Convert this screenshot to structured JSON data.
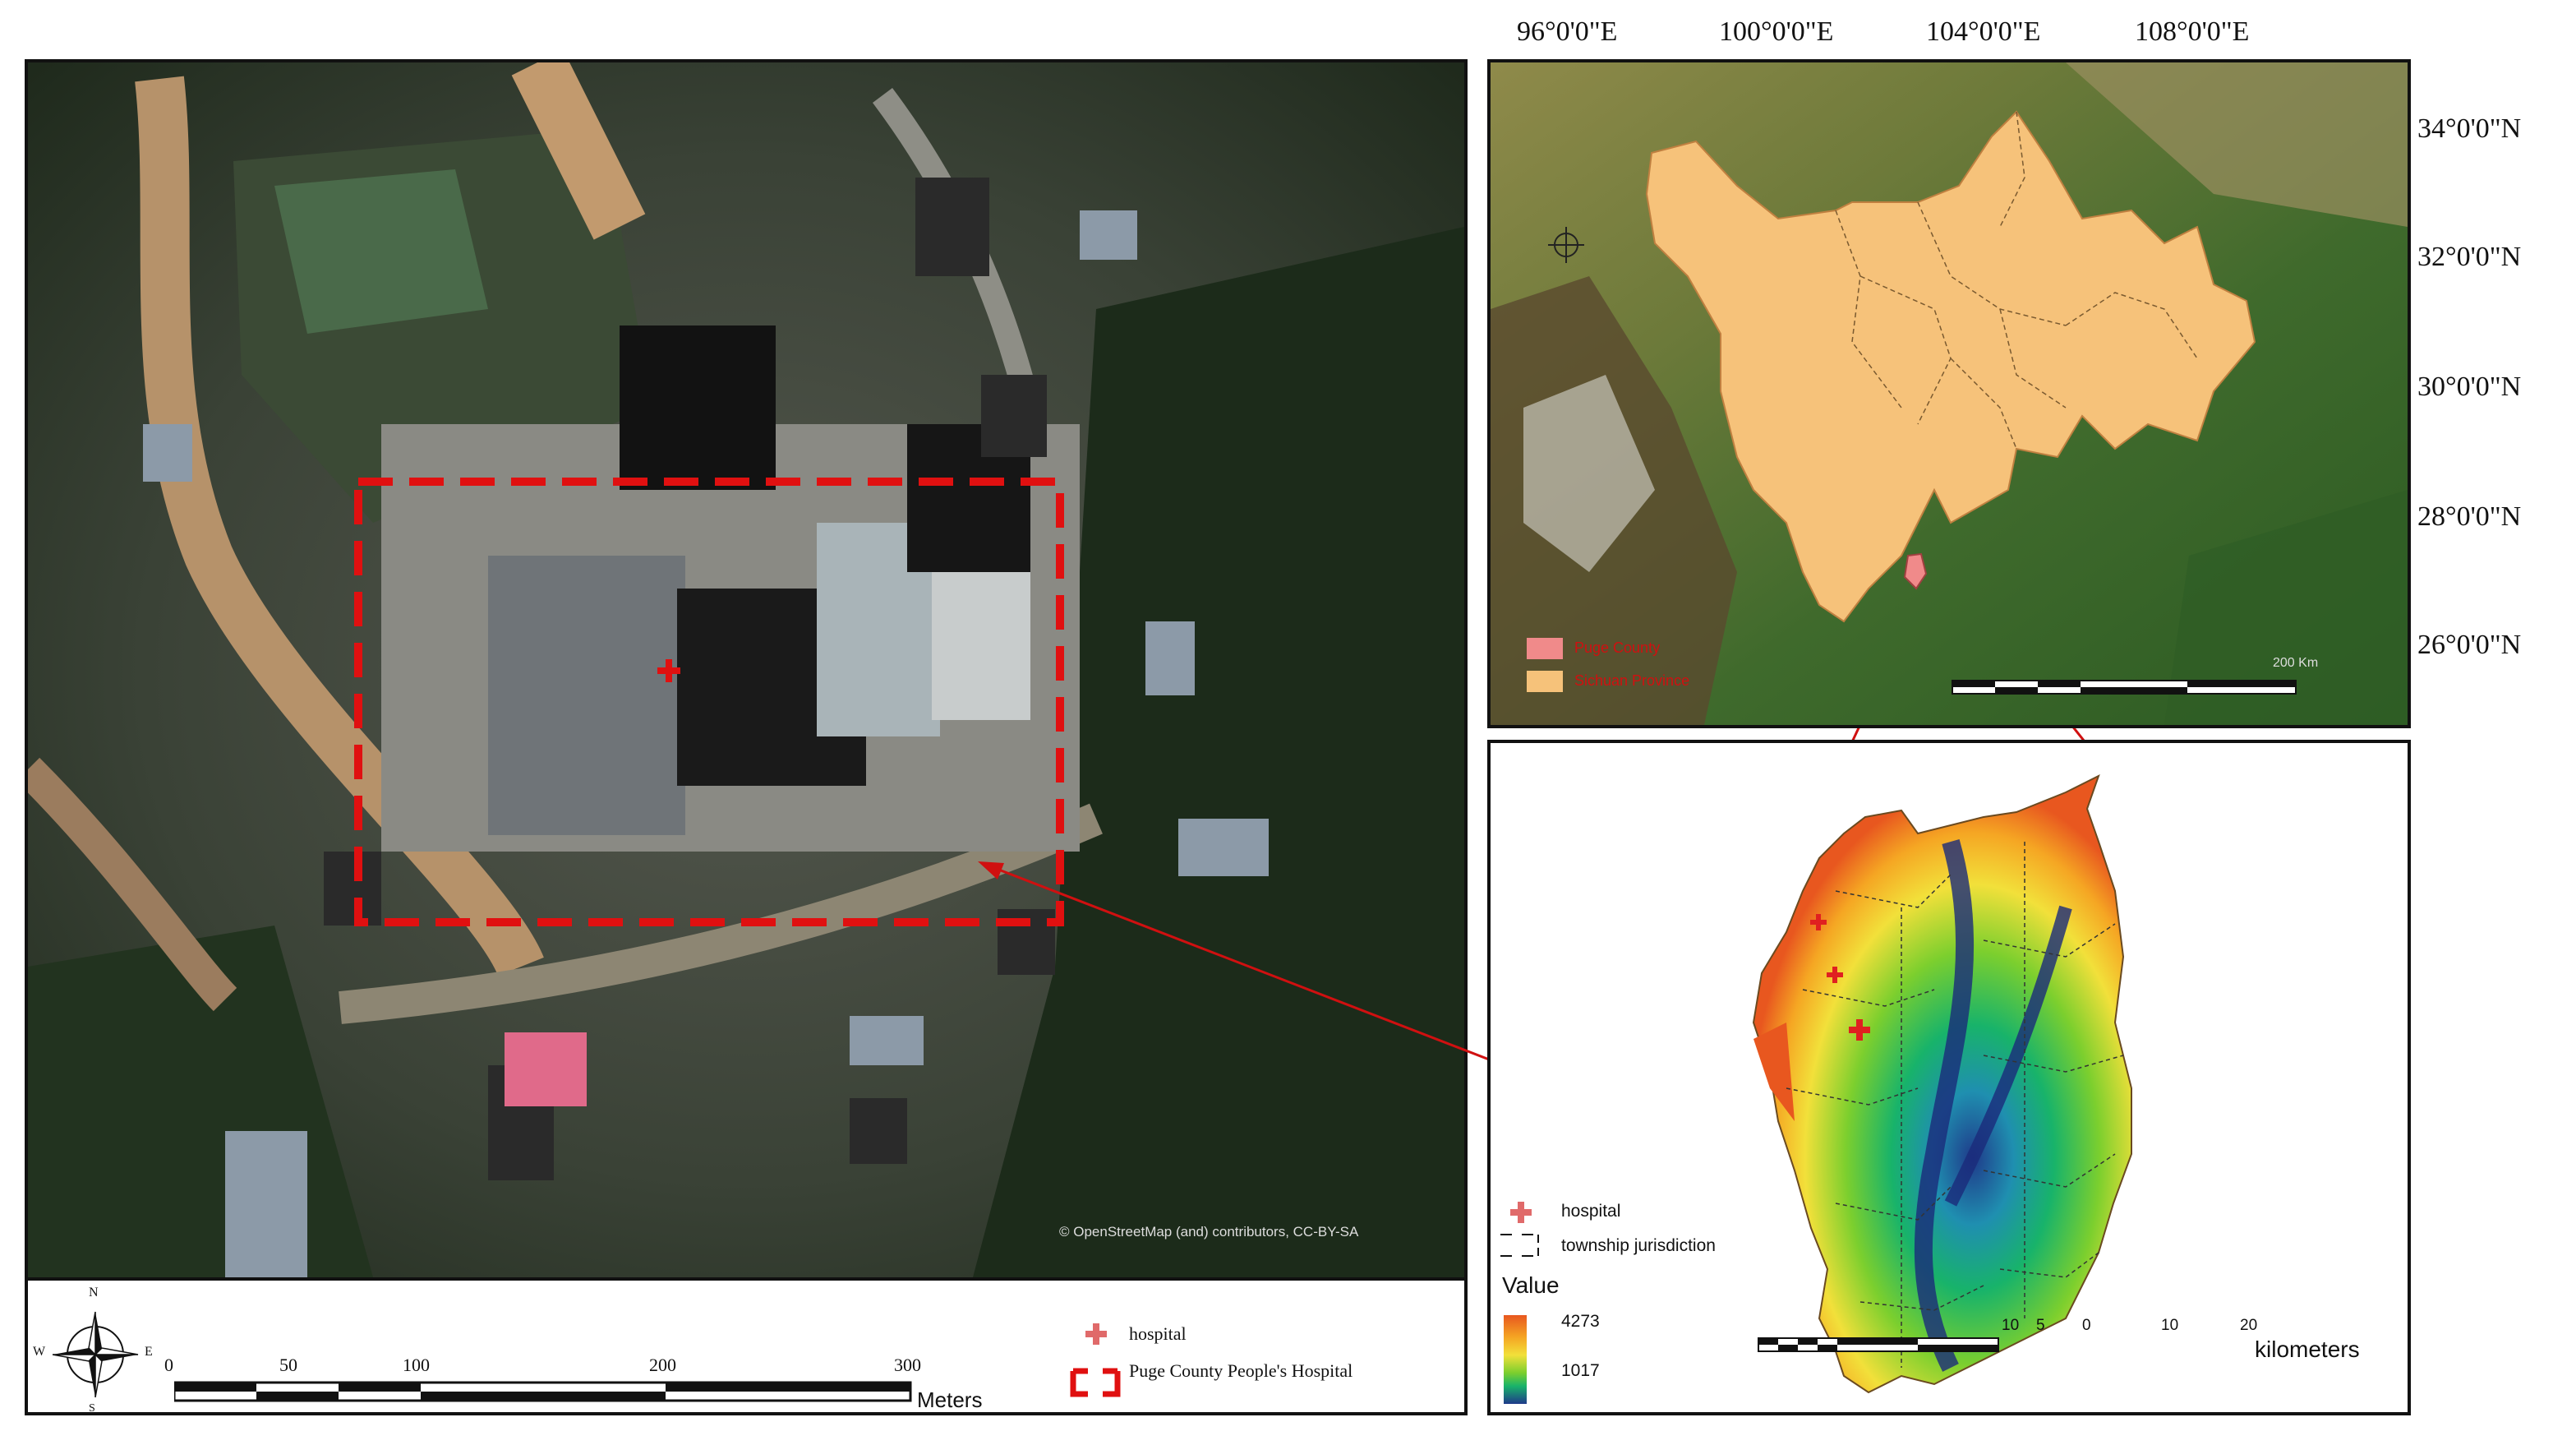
{
  "satellite": {
    "attribution": "© OpenStreetMap (and) contributors, CC-BY-SA"
  },
  "scalebar_main": {
    "ticks": [
      "0",
      "50",
      "100",
      "200",
      "300"
    ],
    "unit": "Meters"
  },
  "compass": {
    "n": "N",
    "e": "E",
    "w": "W",
    "s": "S"
  },
  "legend_main": {
    "hospital": "hospital",
    "boundary": "Puge County People's Hospital"
  },
  "location_map": {
    "lon_labels": [
      "96°0'0\"E",
      "100°0'0\"E",
      "104°0'0\"E",
      "108°0'0\"E"
    ],
    "lat_labels": [
      "34°0'0\"N",
      "32°0'0\"N",
      "30°0'0\"N",
      "28°0'0\"N",
      "26°0'0\"N"
    ],
    "legend": [
      "Puge County",
      "Sichuan Province"
    ],
    "scale_label": "200 Km",
    "colors": {
      "county": "#f08a8a",
      "province": "#f6c27a"
    }
  },
  "dem_map": {
    "legend_hospital": "hospital",
    "legend_township": "township jurisdiction",
    "value_title": "Value",
    "value_max": "4273",
    "value_min": "1017",
    "scale_ticks": [
      "10",
      "5",
      "0",
      "10",
      "20"
    ],
    "scale_unit": "kilometers",
    "ramp": [
      "#e8571f",
      "#f5a623",
      "#f2e03a",
      "#7ccf2e",
      "#18b36a",
      "#1f8fb0",
      "#1f3a8a"
    ]
  }
}
